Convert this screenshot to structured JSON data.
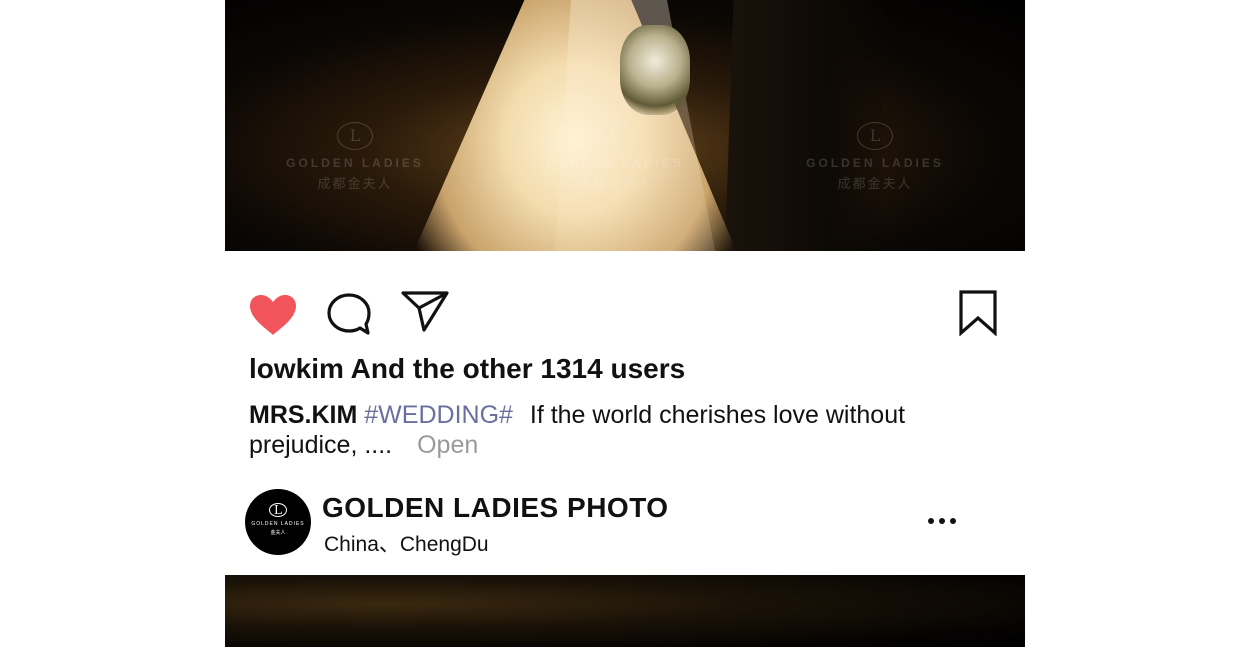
{
  "post": {
    "watermark": {
      "name": "GOLDEN LADIES",
      "cn": "成都金夫人",
      "logo_letter": "L"
    },
    "likes_text": "lowkim And the other 1314 users",
    "caption": {
      "user": "MRS.KIM",
      "tag": "#WEDDING#",
      "text": "If the world cherishes love without prejudice, ....",
      "open_label": "Open"
    }
  },
  "actions": {
    "icons": [
      "heart-icon",
      "comment-icon",
      "share-icon",
      "bookmark-icon"
    ],
    "heart_color": "#f2545b"
  },
  "profile": {
    "name": "GOLDEN LADIES PHOTO",
    "location": "China、ChengDu",
    "avatar": {
      "logo_letter": "L",
      "name": "GOLDEN LADIES",
      "cn": "金夫人"
    }
  }
}
